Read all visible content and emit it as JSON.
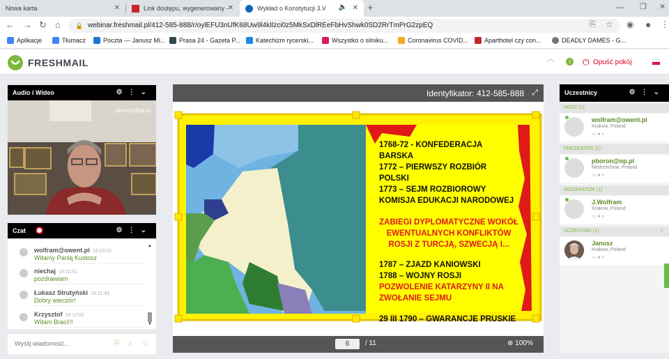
{
  "browser": {
    "tabs": [
      {
        "title": "Nowa karta"
      },
      {
        "title": "Link dostępu, wygenerowany - W"
      },
      {
        "title": "Wykład o Konstytucji 3.V"
      }
    ],
    "url": "webinar.freshmail.pl/412-585-888/r/oylEFU3nUfK68Uw9l4kIlzci0z5MkSxDlREeFbHvShwk0SD2RrTmPrG2zpEQ",
    "bookmarks": [
      "Aplikacje",
      "Tłumacz",
      "Poczta — Janusz Mi...",
      "Prasa 24 - Gazeta P...",
      "Katechizm rycerski...",
      "Wszystko o silniku...",
      "Coronavirus COVID...",
      "Aparthotel czy con...",
      "DEADLY DAMES - G..."
    ]
  },
  "app": {
    "logo": "FRESHMAIL",
    "leave_label": "Opuść pokój"
  },
  "video_panel": {
    "title": "Audio i Wideo",
    "username": "pboron@op.pl"
  },
  "chat": {
    "title": "Czat",
    "messages": [
      {
        "name": "wolfram@owent.pl",
        "time": "19:10:02",
        "text": "Witamy Panią Kustosz"
      },
      {
        "name": "niechaj",
        "time": "19:10:51",
        "text": "pozdrawiam"
      },
      {
        "name": "Łukasz Strutyński",
        "time": "19:11:43",
        "text": "Dobry wieczór!"
      },
      {
        "name": "Krzysztof",
        "time": "19:12:02",
        "text": "Witam Braci!!!"
      }
    ],
    "input_placeholder": "Wyślij wiadomość..."
  },
  "presentation": {
    "identifier": "Identyfikator: 412-585-888",
    "current_page": "6",
    "total_pages": "/ 11",
    "zoom": "100%",
    "slide": {
      "black_lines_1": [
        "1768-72 - KONFEDERACJA BARSKA",
        "1772 – PIERWSZY ROZBIÓR POLSKI",
        "1773 – SEJM ROZBIOROWY",
        "KOMISJA EDUKACJI NARODOWEJ"
      ],
      "red_lines_1": [
        "ZABIEGI DYPLOMATYCZNE WOKÓŁ",
        "EWENTUALNYCH KONFLIKTÓW",
        "ROSJI Z TURCJĄ, SZWECJĄ I..."
      ],
      "black_lines_2": [
        "1787 – ZJAZD KANIOWSKI",
        "1788 – WOJNY ROSJI"
      ],
      "red_lines_2": [
        "POZWOLENIE KATARZYNY II NA",
        "ZWOŁANIE SEJMU"
      ],
      "black_lines_3": [
        "29 III 1790 – GWARANCJE PRUSKIE"
      ]
    }
  },
  "participants": {
    "title": "Uczestnicy",
    "groups": [
      {
        "role": "HOST (1)",
        "name": "wolfram@owent.pl",
        "location": "Krakow, Poland"
      },
      {
        "role": "PREZENTER (1)",
        "name": "pboron@op.pl",
        "location": "Medrzechow, Poland"
      },
      {
        "role": "MODERATOR (1)",
        "name": "J.Wolfram",
        "location": "Krakow, Poland"
      },
      {
        "role": "UCZESTNIK (1)",
        "name": "Janusz",
        "location": "Krakow, Poland"
      }
    ]
  }
}
